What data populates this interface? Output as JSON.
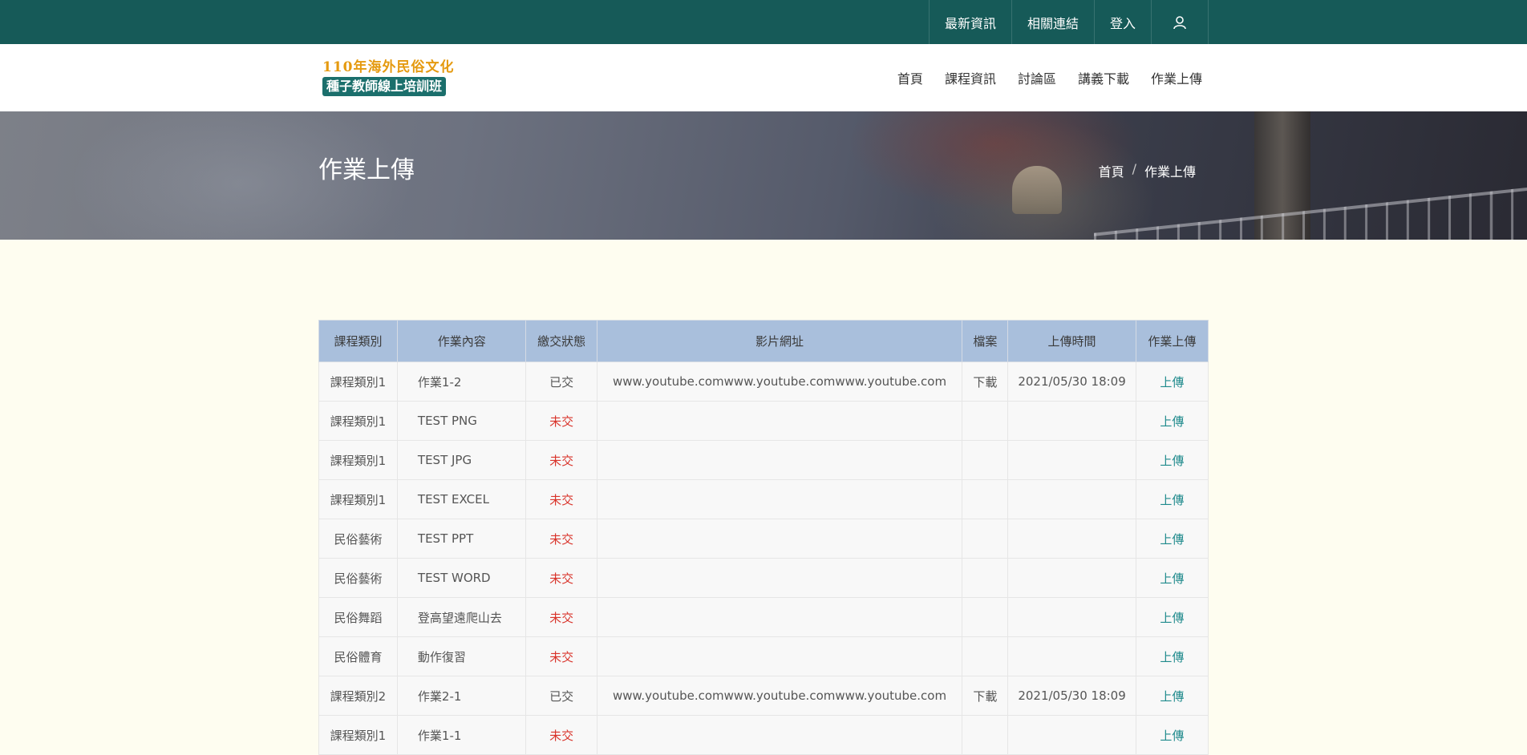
{
  "topbar": {
    "links": [
      "最新資訊",
      "相關連結",
      "登入"
    ],
    "user_icon": "user-icon"
  },
  "header": {
    "logo_line1": "110年海外民俗文化",
    "logo_line2": "種子教師線上培訓班",
    "nav": [
      "首頁",
      "課程資訊",
      "討論區",
      "講義下載",
      "作業上傳"
    ]
  },
  "hero": {
    "title": "作業上傳",
    "breadcrumb": [
      "首頁",
      "作業上傳"
    ],
    "separator": "/"
  },
  "table": {
    "headers": [
      "課程類別",
      "作業內容",
      "繳交狀態",
      "影片網址",
      "檔案",
      "上傳時間",
      "作業上傳"
    ],
    "rows": [
      {
        "category": "課程類別1",
        "content": "作業1-2",
        "status": "已交",
        "video": "www.youtube.comwww.youtube.comwww.youtube.com",
        "file": "下載",
        "time": "2021/05/30 18:09",
        "upload": "上傳"
      },
      {
        "category": "課程類別1",
        "content": "TEST PNG",
        "status": "未交",
        "video": "",
        "file": "",
        "time": "",
        "upload": "上傳"
      },
      {
        "category": "課程類別1",
        "content": "TEST JPG",
        "status": "未交",
        "video": "",
        "file": "",
        "time": "",
        "upload": "上傳"
      },
      {
        "category": "課程類別1",
        "content": "TEST EXCEL",
        "status": "未交",
        "video": "",
        "file": "",
        "time": "",
        "upload": "上傳"
      },
      {
        "category": "民俗藝術",
        "content": "TEST PPT",
        "status": "未交",
        "video": "",
        "file": "",
        "time": "",
        "upload": "上傳"
      },
      {
        "category": "民俗藝術",
        "content": "TEST WORD",
        "status": "未交",
        "video": "",
        "file": "",
        "time": "",
        "upload": "上傳"
      },
      {
        "category": "民俗舞蹈",
        "content": "登高望遠爬山去",
        "status": "未交",
        "video": "",
        "file": "",
        "time": "",
        "upload": "上傳"
      },
      {
        "category": "民俗體育",
        "content": "動作復習",
        "status": "未交",
        "video": "",
        "file": "",
        "time": "",
        "upload": "上傳"
      },
      {
        "category": "課程類別2",
        "content": "作業2-1",
        "status": "已交",
        "video": "www.youtube.comwww.youtube.comwww.youtube.com",
        "file": "下載",
        "time": "2021/05/30 18:09",
        "upload": "上傳"
      },
      {
        "category": "課程類別1",
        "content": "作業1-1",
        "status": "未交",
        "video": "",
        "file": "",
        "time": "",
        "upload": "上傳"
      }
    ]
  },
  "colors": {
    "topbar": "#165a58",
    "table_header": "#a9bfdc",
    "pending": "#d9342b",
    "link": "#1f8a8c",
    "page_bg": "#fefdf0"
  }
}
